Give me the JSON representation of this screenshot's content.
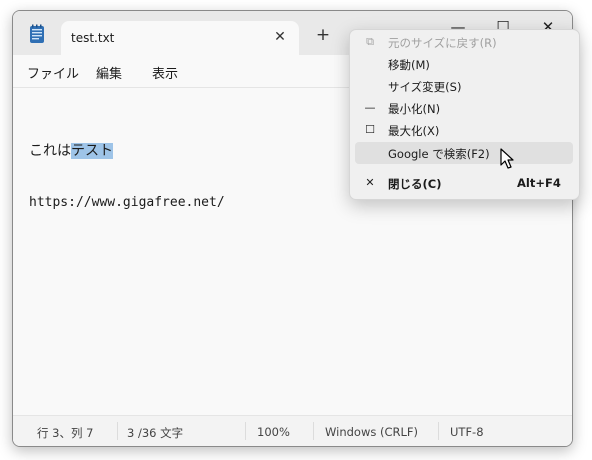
{
  "tab": {
    "title": "test.txt"
  },
  "menu": {
    "file": "ファイル",
    "edit": "編集",
    "view": "表示"
  },
  "editor": {
    "line1_plain": "これは",
    "line1_selected": "テスト",
    "line2": "https://www.gigafree.net/"
  },
  "status": {
    "position": "行 3、列 7",
    "chars": "3 /36 文字",
    "zoom": "100%",
    "eol": "Windows (CRLF)",
    "encoding": "UTF-8"
  },
  "context_menu": {
    "items": [
      {
        "icon": "restore-icon",
        "label": "元のサイズに戻す(R)",
        "shortcut": "",
        "disabled": true
      },
      {
        "icon": "",
        "label": "移動(M)",
        "shortcut": "",
        "disabled": false
      },
      {
        "icon": "",
        "label": "サイズ変更(S)",
        "shortcut": "",
        "disabled": false
      },
      {
        "icon": "minimize-icon",
        "label": "最小化(N)",
        "shortcut": "",
        "disabled": false
      },
      {
        "icon": "maximize-icon",
        "label": "最大化(X)",
        "shortcut": "",
        "disabled": false
      },
      {
        "icon": "",
        "label": "Google で検索(F2)",
        "shortcut": "",
        "disabled": false
      },
      {
        "icon": "close-icon",
        "label": "閉じる(C)",
        "shortcut": "Alt+F4",
        "disabled": false
      }
    ]
  },
  "colors": {
    "selection": "#9ec4e8",
    "hover": "#e0e0e0"
  }
}
